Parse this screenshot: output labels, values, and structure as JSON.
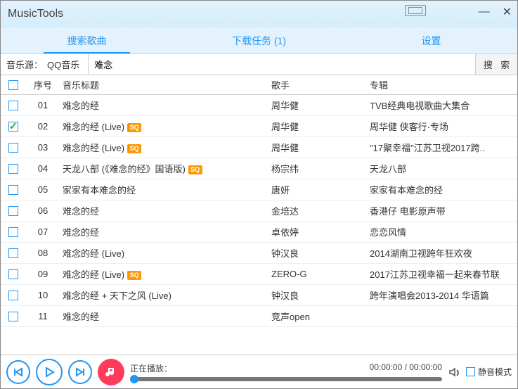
{
  "window": {
    "title": "MusicTools"
  },
  "tabs": {
    "search": "搜索歌曲",
    "download": "下载任务 (1)",
    "settings": "设置"
  },
  "searchbar": {
    "src_label": "音乐源：",
    "src_value": "QQ音乐",
    "query": "难念",
    "button": "搜 索"
  },
  "header": {
    "num": "序号",
    "title": "音乐标题",
    "artist": "歌手",
    "album": "专辑"
  },
  "rows": [
    {
      "num": "01",
      "title": "难念的经",
      "sq": false,
      "artist": "周华健",
      "album": "TVB经典电视歌曲大集合",
      "checked": false
    },
    {
      "num": "02",
      "title": "难念的经 (Live)",
      "sq": true,
      "artist": "周华健",
      "album": "周华健 侠客行·专场",
      "checked": true
    },
    {
      "num": "03",
      "title": "难念的经 (Live)",
      "sq": true,
      "artist": "周华健",
      "album": "\"17聚幸福\"江苏卫视2017跨..",
      "checked": false
    },
    {
      "num": "04",
      "title": "天龙八部 (《难念的经》国语版)",
      "sq": true,
      "artist": "杨宗纬",
      "album": "天龙八部",
      "checked": false
    },
    {
      "num": "05",
      "title": "家家有本难念的经",
      "sq": false,
      "artist": "唐妍",
      "album": "家家有本难念的经",
      "checked": false
    },
    {
      "num": "06",
      "title": "难念的经",
      "sq": false,
      "artist": "金培达",
      "album": "香港仔 电影原声带",
      "checked": false
    },
    {
      "num": "07",
      "title": "难念的经",
      "sq": false,
      "artist": "卓依婷",
      "album": "恋恋风情",
      "checked": false
    },
    {
      "num": "08",
      "title": "难念的经 (Live)",
      "sq": false,
      "artist": "钟汉良",
      "album": "2014湖南卫视跨年狂欢夜",
      "checked": false
    },
    {
      "num": "09",
      "title": "难念的经 (Live)",
      "sq": true,
      "artist": "ZERO-G",
      "album": "2017江苏卫视幸福一起来春节联",
      "checked": false
    },
    {
      "num": "10",
      "title": "难念的经 + 天下之风 (Live)",
      "sq": false,
      "artist": "钟汉良",
      "album": "跨年演唱会2013-2014 华语篇",
      "checked": false
    },
    {
      "num": "11",
      "title": "难念的经",
      "sq": false,
      "artist": "竞声open",
      "album": "",
      "checked": false
    }
  ],
  "player": {
    "now_label": "正在播放：",
    "time": "00:00:00 / 00:00:00",
    "mute": "静音模式"
  }
}
